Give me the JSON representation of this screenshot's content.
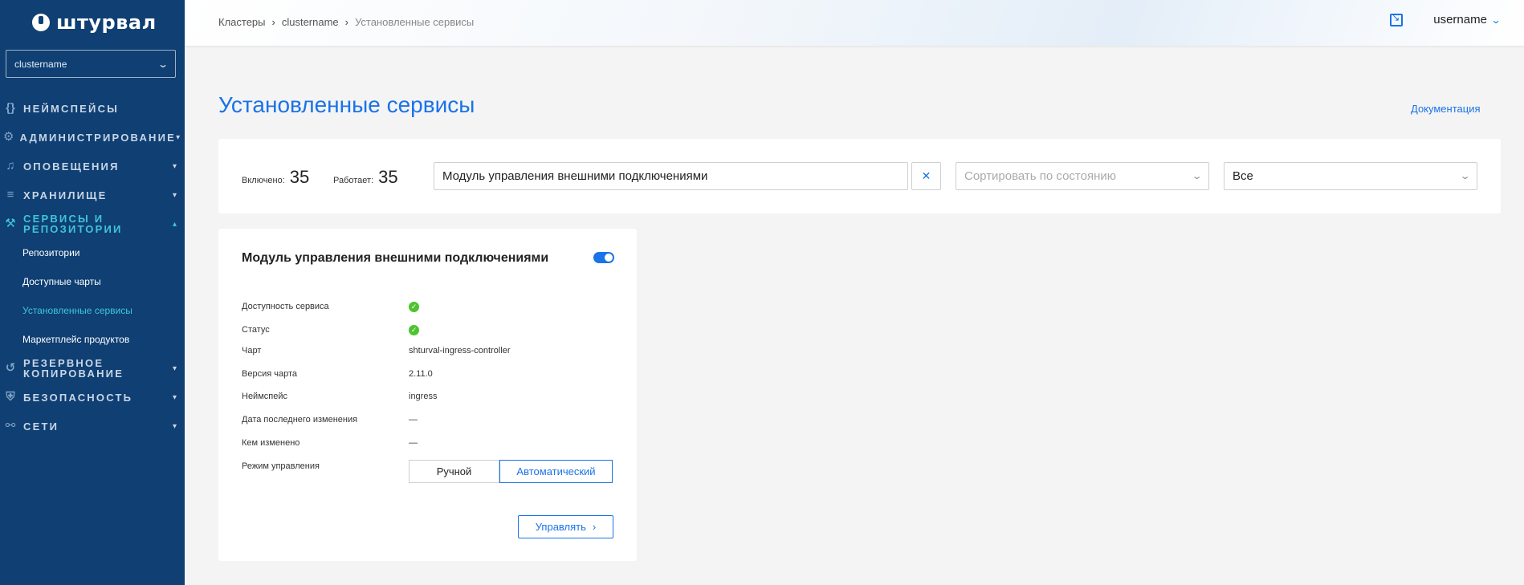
{
  "sidebar": {
    "logo": "штурвал",
    "cluster_select": "clustername",
    "items": [
      {
        "label": "Неймспейсы",
        "icon": "braces-icon"
      },
      {
        "label": "Администрирование",
        "icon": "gear-icon"
      },
      {
        "label": "Оповещения",
        "icon": "bell-icon"
      },
      {
        "label": "Хранилище",
        "icon": "database-icon"
      },
      {
        "label": "Сервисы и репозитории",
        "icon": "wrench-icon"
      },
      {
        "label": "Резервное копирование",
        "icon": "backup-icon"
      },
      {
        "label": "Безопасность",
        "icon": "shield-icon"
      },
      {
        "label": "Сети",
        "icon": "network-icon"
      }
    ],
    "sub_items": [
      "Репозитории",
      "Доступные чарты",
      "Установленные сервисы",
      "Маркетплейс продуктов"
    ]
  },
  "breadcrumb": [
    "Кластеры",
    "clustername",
    "Установленные сервисы"
  ],
  "user": "username",
  "page": {
    "title": "Установленные сервисы",
    "doc_link": "Документация"
  },
  "filters": {
    "enabled_label": "Включено:",
    "enabled_value": "35",
    "running_label": "Работает:",
    "running_value": "35",
    "search_value": "Модуль управления внешними подключениями",
    "clear": "✕",
    "sort_placeholder": "Сортировать по состоянию",
    "scope_value": "Все"
  },
  "card": {
    "title": "Модуль управления внешними подключениями",
    "rows": [
      {
        "k": "Доступность сервиса",
        "v": "✓"
      },
      {
        "k": "Статус",
        "v": "✓"
      },
      {
        "k": "Чарт",
        "v": "shturval-ingress-controller"
      },
      {
        "k": "Версия чарта",
        "v": "2.11.0"
      },
      {
        "k": "Неймспейс",
        "v": "ingress"
      },
      {
        "k": "Дата последнего изменения",
        "v": "—"
      },
      {
        "k": "Кем изменено",
        "v": "—"
      },
      {
        "k": "Режим управления",
        "v": ""
      }
    ],
    "mode_manual": "Ручной",
    "mode_auto": "Автоматический",
    "manage": "Управлять"
  }
}
